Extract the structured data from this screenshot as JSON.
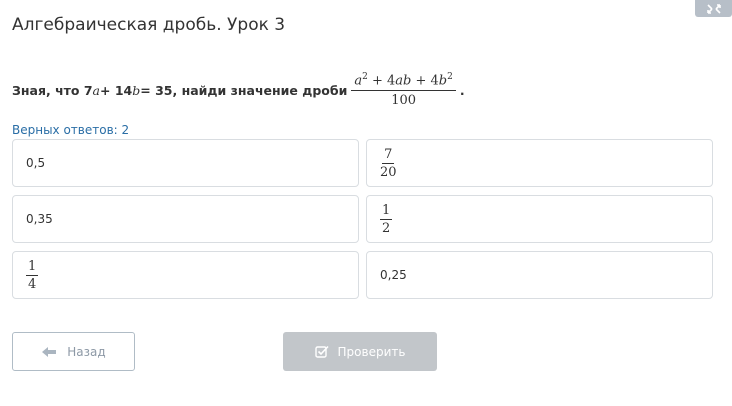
{
  "header": {
    "title": "Алгебраическая дробь. Урок 3",
    "corner_icon": "expand-icon"
  },
  "question": {
    "prefix": "Зная, что 7",
    "var_a": "a",
    "mid1": " + 14",
    "var_b": "b",
    "mid2": " = 35, найди значение дроби",
    "fraction_numerator": {
      "a": "a",
      "a_exp": "2",
      "plus1": " + 4",
      "ab": "ab",
      "plus2": " + 4",
      "b": "b",
      "b_exp": "2"
    },
    "fraction_denominator": "100",
    "suffix": "."
  },
  "correct_answers": {
    "label": "Верных ответов: 2"
  },
  "options": [
    {
      "id": "opt1",
      "type": "text",
      "text": "0,5"
    },
    {
      "id": "opt2",
      "type": "fraction",
      "numerator": "7",
      "denominator": "20"
    },
    {
      "id": "opt3",
      "type": "text",
      "text": "0,35"
    },
    {
      "id": "opt4",
      "type": "fraction",
      "numerator": "1",
      "denominator": "2"
    },
    {
      "id": "opt5",
      "type": "fraction",
      "numerator": "1",
      "denominator": "4"
    },
    {
      "id": "opt6",
      "type": "text",
      "text": "0,25"
    }
  ],
  "buttons": {
    "back_label": "Назад",
    "back_icon": "arrow-left-icon",
    "check_label": "Проверить",
    "check_icon": "checkbox-icon"
  },
  "colors": {
    "accent_text": "#2a6ea6",
    "disabled_button": "#c2c6ca",
    "border": "#d9dde1"
  }
}
